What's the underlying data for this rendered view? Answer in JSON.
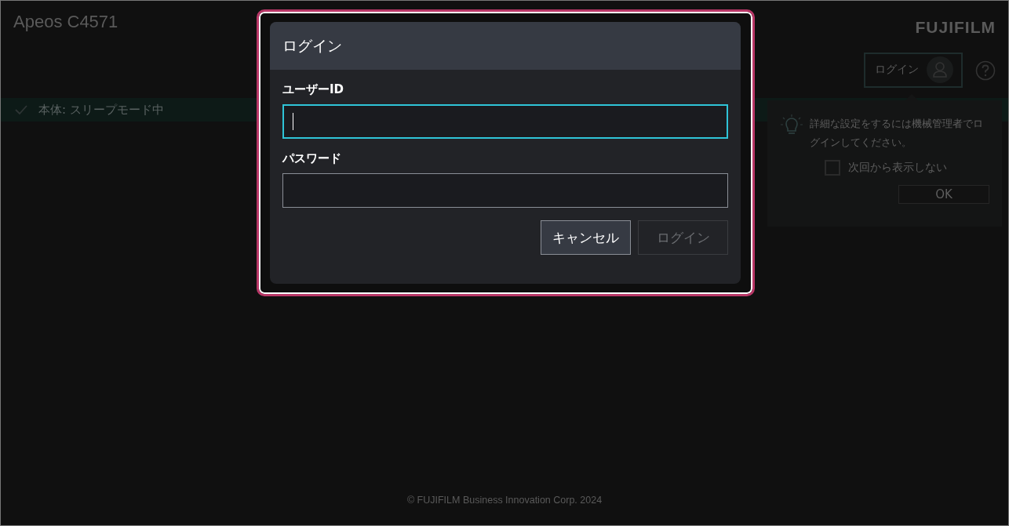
{
  "header": {
    "title": "Apeos C4571",
    "logo": "FUJIFILM",
    "login_button": "ログイン"
  },
  "status_bar": {
    "text": "本体: スリープモード中",
    "ok": true
  },
  "tip": {
    "message": "詳細な設定をするには機械管理者でログインしてください。",
    "checkbox": {
      "label": "次回から表示しない",
      "checked": false
    },
    "ok_button": "OK"
  },
  "dialog": {
    "title": "ログイン",
    "highlighted": true,
    "fields": [
      {
        "label": "ユーザーID",
        "focused": true
      },
      {
        "label": "パスワード",
        "focused": false
      }
    ],
    "buttons": [
      {
        "label": "キャンセル",
        "disabled": false
      },
      {
        "label": "ログイン",
        "disabled": true
      }
    ]
  },
  "footer": "© FUJIFILM Business Innovation Corp. 2024"
}
